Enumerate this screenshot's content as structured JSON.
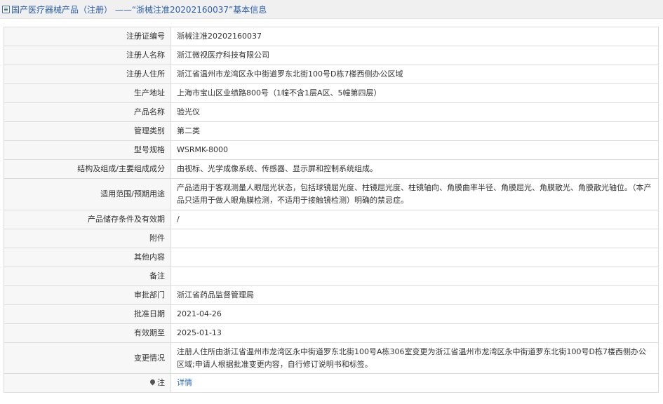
{
  "header": {
    "icon": "document-list-icon",
    "title": "国产医疗器械产品（注册） ——“浙械注准20202160037”基本信息"
  },
  "rows": [
    {
      "label": "注册证编号",
      "value": "浙械注准20202160037"
    },
    {
      "label": "注册人名称",
      "value": "浙江微视医疗科技有限公司"
    },
    {
      "label": "注册人住所",
      "value": "浙江省温州市龙湾区永中街道罗东北街100号D栋7楼西侧办公区域"
    },
    {
      "label": "生产地址",
      "value": "上海市宝山区业绩路800号（1幢不含1层A区、5幢第四层）"
    },
    {
      "label": "产品名称",
      "value": "验光仪"
    },
    {
      "label": "管理类别",
      "value": "第二类"
    },
    {
      "label": "型号规格",
      "value": "WSRMK-8000"
    },
    {
      "label": "结构及组成/主要组成成分",
      "value": "由视标、光学成像系统、传感器、显示屏和控制系统组成。"
    },
    {
      "label": "适用范围/预期用途",
      "value": "产品适用于客观测量人眼屈光状态，包括球镜屈光度、柱镜屈光度、柱镜轴向、角膜曲率半径、角膜屈光、角膜散光、角膜散光轴位。（本产品只适用于做人眼角膜检测，不适用于接触镜检测）明确的禁忌症。"
    },
    {
      "label": "产品储存条件及有效期",
      "value": "/"
    },
    {
      "label": "附件",
      "value": ""
    },
    {
      "label": "其他内容",
      "value": ""
    },
    {
      "label": "备注",
      "value": ""
    },
    {
      "label": "审批部门",
      "value": "浙江省药品监督管理局"
    },
    {
      "label": "批准日期",
      "value": "2021-04-26"
    },
    {
      "label": "有效期至",
      "value": "2025-01-13"
    },
    {
      "label": "变更情况",
      "value": "注册人住所由浙江省温州市龙湾区永中街道罗东北街100号A栋306室变更为浙江省温州市龙湾区永中街道罗东北街100号D栋7楼西侧办公区域;申请人根据批准变更内容，自行修订说明书和标签。"
    }
  ],
  "detail_row": {
    "icon": "location-pin-icon",
    "label": "注",
    "link": "详情"
  }
}
